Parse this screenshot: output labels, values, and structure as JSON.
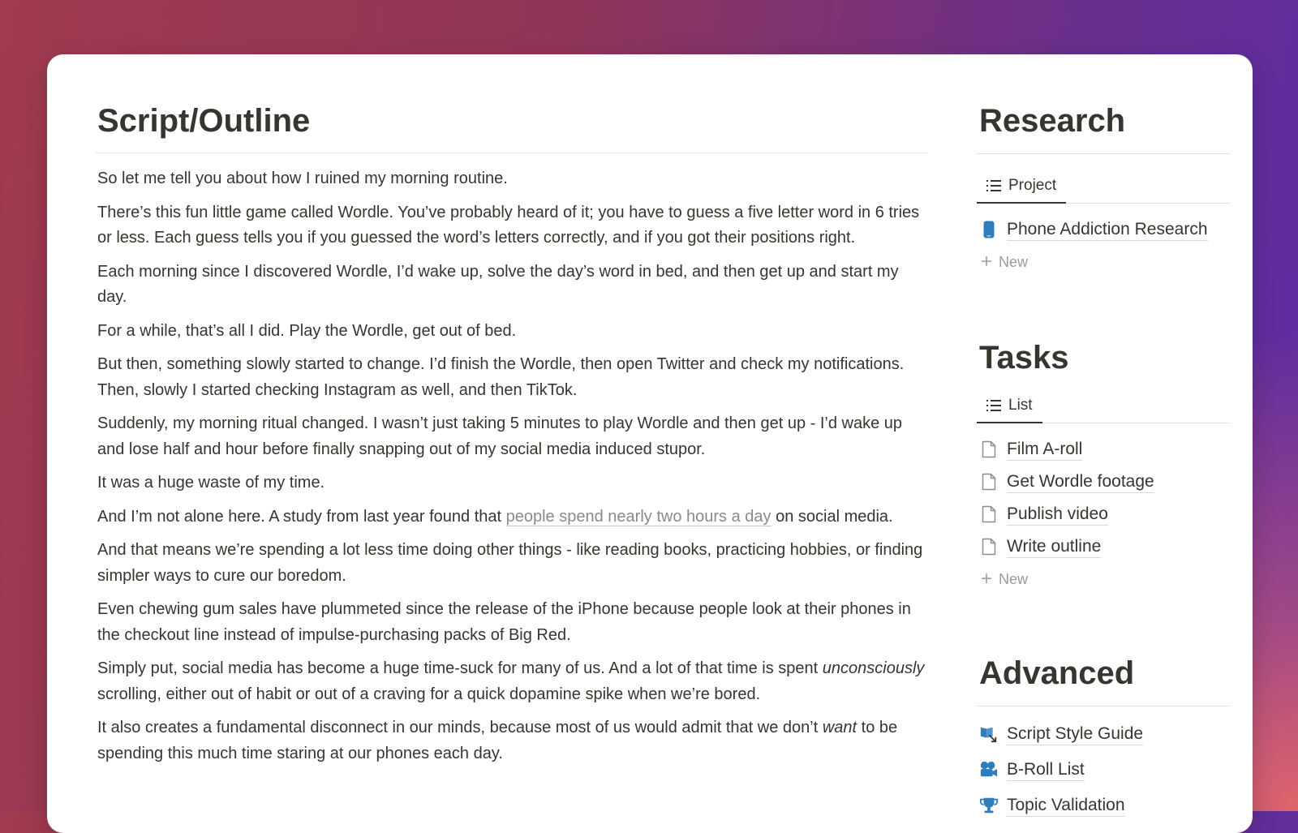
{
  "script": {
    "title": "Script/Outline",
    "paragraphs": [
      "So let me tell you about how I ruined my morning routine.",
      "There’s this fun little game called Wordle. You’ve probably heard of it; you have to guess a five letter word in 6 tries or less. Each guess tells you if you guessed the word’s letters correctly, and if you got their positions right.",
      "Each morning since I discovered Wordle, I’d wake up, solve the day’s word in bed, and then get up and start my day.",
      "For a while, that’s all I did. Play the Wordle, get out of bed.",
      "But then, something slowly started to change. I’d finish the Wordle, then open Twitter and check my notifications. Then, slowly I started checking Instagram as well, and then TikTok.",
      "Suddenly, my morning ritual changed. I wasn’t just taking 5 minutes to play Wordle and then get up - I’d wake up and lose half and hour before finally snapping out of my social media induced stupor.",
      "It was a huge waste of my time."
    ],
    "para_study": {
      "before": "And I’m not alone here. A study from last year found that ",
      "link": "people spend nearly two hours a day",
      "after": " on social media."
    },
    "paragraphs_b": [
      "And that means we’re spending a lot less time doing other things - like reading books, practicing hobbies, or finding simpler ways to cure our boredom.",
      "Even chewing gum sales have plummeted since the release of the iPhone because people look at their phones in the checkout line instead of impulse-purchasing packs of Big Red."
    ],
    "para_unconscious": {
      "before": "Simply put, social media has become a huge time-suck for many of us. And a lot of that time is spent ",
      "em": "unconsciously",
      "after": " scrolling, either out of habit or out of a craving for a quick dopamine spike when we’re bored."
    },
    "para_last": {
      "before": "It also creates a fundamental disconnect in our minds, because most of us would admit that we don’t ",
      "em": "want",
      "after": " to be spending this much time staring at our phones each day."
    }
  },
  "research": {
    "title": "Research",
    "view_label": "Project",
    "view_icon": "list-icon",
    "items": [
      {
        "label": "Phone Addiction Research",
        "icon": "phone-icon",
        "color": "#2e7dbd"
      }
    ],
    "new_label": "New"
  },
  "tasks": {
    "title": "Tasks",
    "view_label": "List",
    "view_icon": "list-icon",
    "items": [
      {
        "label": "Film A-roll",
        "icon": "page-icon"
      },
      {
        "label": "Get Wordle footage",
        "icon": "page-icon"
      },
      {
        "label": "Publish video",
        "icon": "page-icon"
      },
      {
        "label": "Write outline",
        "icon": "page-icon"
      }
    ],
    "new_label": "New"
  },
  "advanced": {
    "title": "Advanced",
    "items": [
      {
        "label": "Script Style Guide",
        "icon": "style-guide-icon",
        "color": "#2e7dbd"
      },
      {
        "label": "B-Roll List",
        "icon": "film-camera-icon",
        "color": "#2e7dbd"
      },
      {
        "label": "Topic Validation",
        "icon": "trophy-icon",
        "color": "#2e7dbd"
      }
    ]
  }
}
